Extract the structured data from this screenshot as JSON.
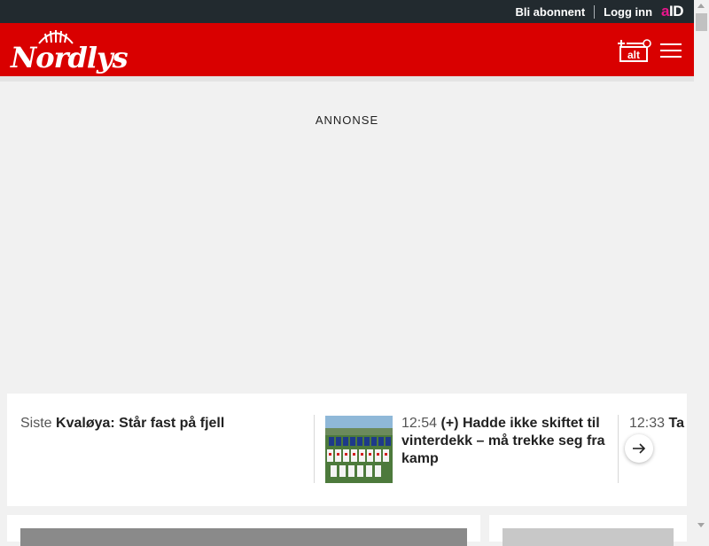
{
  "topbar": {
    "subscribe_label": "Bli abonnent",
    "login_label": "Logg inn",
    "aid_a": "a",
    "aid_id": "ID"
  },
  "header": {
    "logo_text": "Nordlys",
    "plus_alt_label": "alt",
    "menu_icon": "hamburger-icon"
  },
  "ad": {
    "label": "ANNONSE"
  },
  "news_ticker": {
    "items": [
      {
        "time": "Siste",
        "headline": "Kvaløya: Står fast på fjell"
      },
      {
        "time": "12:54",
        "headline": "(+) Hadde ikke skiftet til vinterdekk – må trekke seg fra kamp"
      },
      {
        "time": "12:33",
        "headline": "Ta på flyp"
      }
    ],
    "next_icon": "arrow-right-icon"
  },
  "colors": {
    "brand_red": "#d90000",
    "topbar_bg": "#222a2f",
    "aid_pink": "#e8168c"
  }
}
